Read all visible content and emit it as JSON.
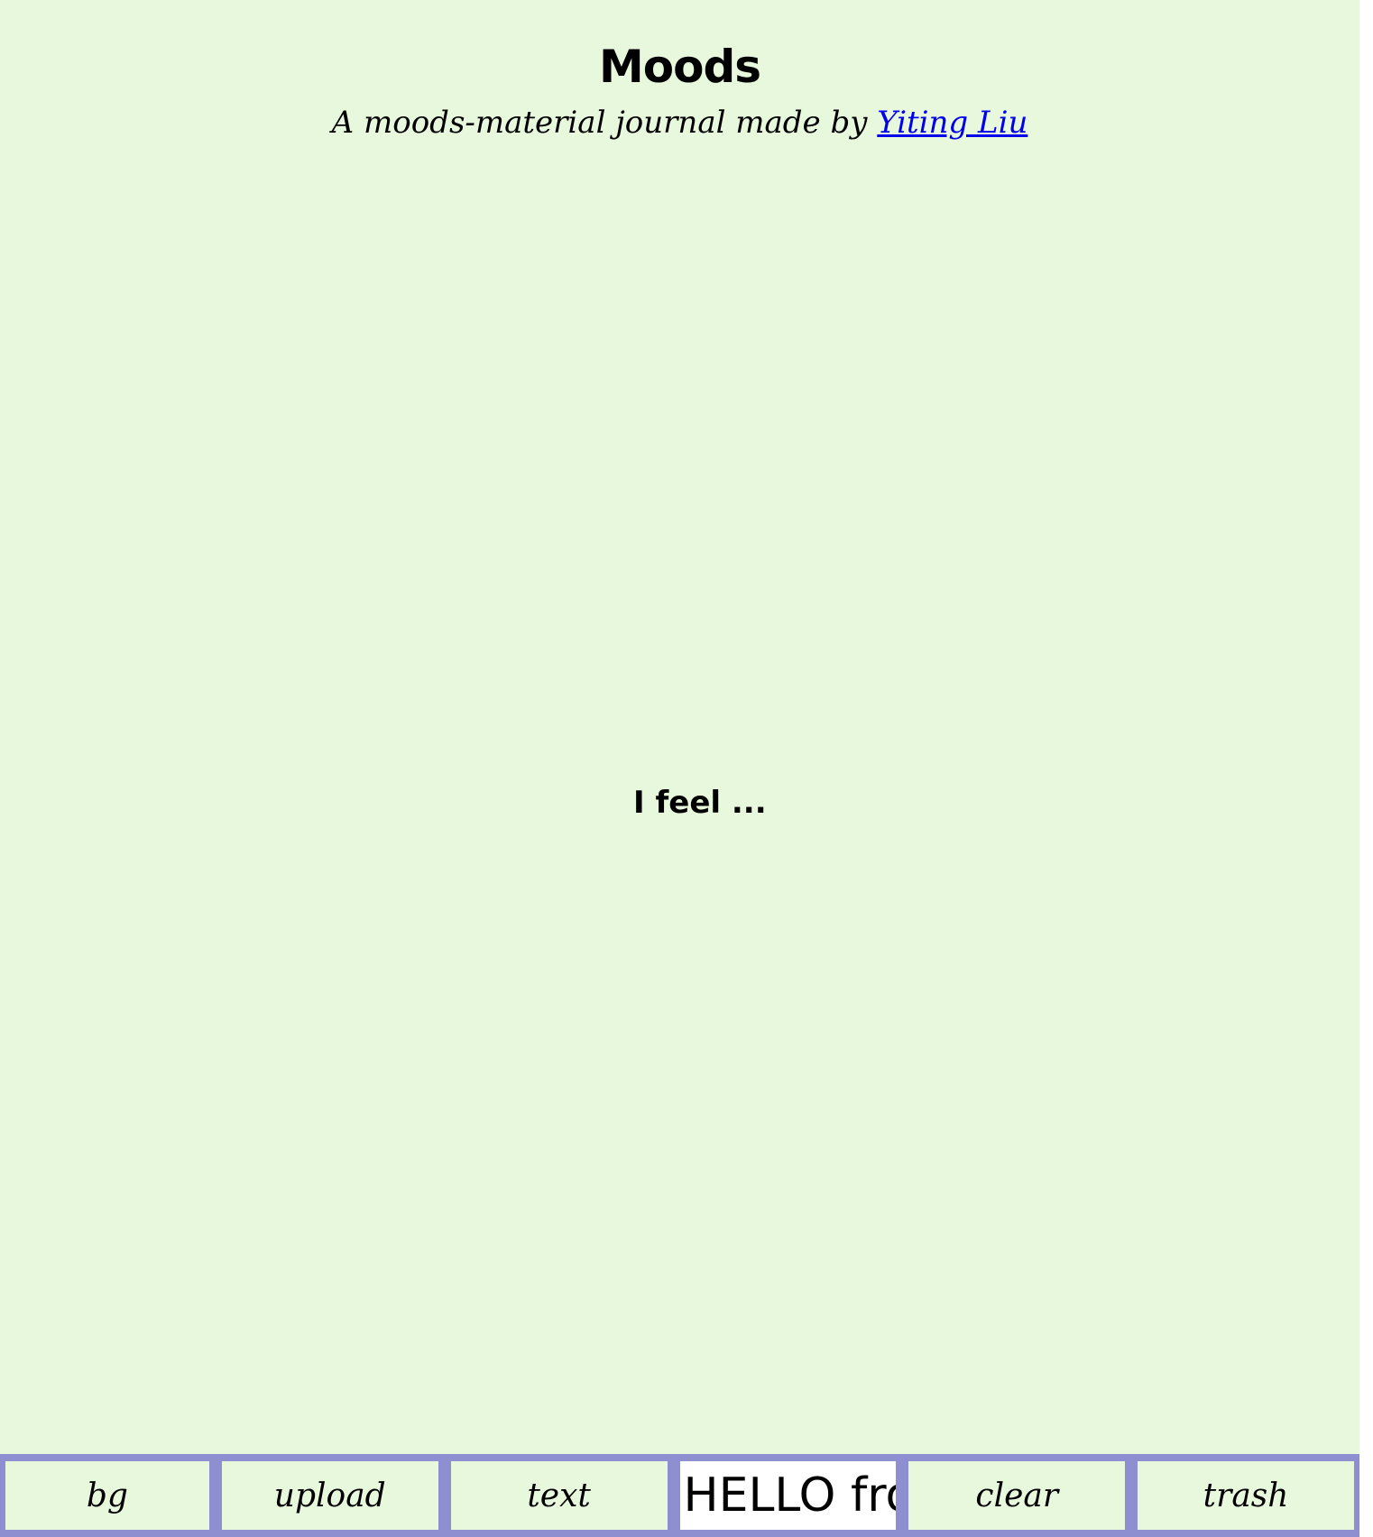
{
  "header": {
    "title": "Moods",
    "subtitle_prefix": "A moods-material journal made by ",
    "author_link": "Yiting Liu"
  },
  "canvas": {
    "prompt": "I feel ..."
  },
  "toolbar": {
    "bg_label": "bg",
    "upload_label": "upload",
    "text_label": "text",
    "sample_text": "HELLO fro",
    "clear_label": "clear",
    "trash_label": "trash"
  },
  "colors": {
    "background": "#e8f8dc",
    "toolbar": "#8d8fd0",
    "link": "#0000ee"
  }
}
